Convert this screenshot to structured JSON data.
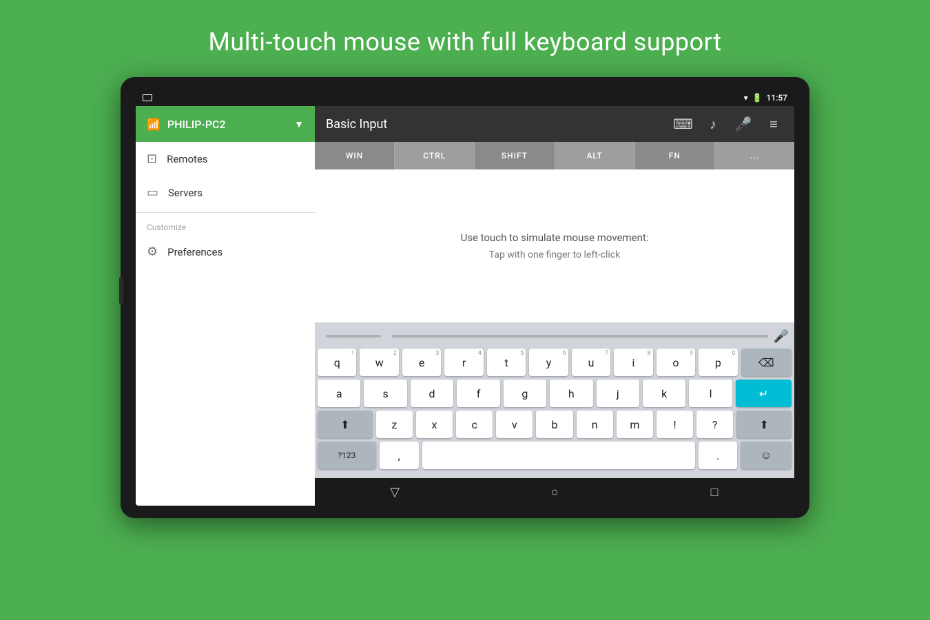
{
  "page": {
    "title": "Multi-touch mouse with full keyboard support",
    "background_color": "#4CAF50"
  },
  "status_bar": {
    "time": "11:57",
    "left_icon": "screen-icon"
  },
  "drawer": {
    "server_name": "PHILIP-PC2",
    "items": [
      {
        "id": "remotes",
        "label": "Remotes",
        "icon": "remotes-icon"
      },
      {
        "id": "servers",
        "label": "Servers",
        "icon": "servers-icon"
      }
    ],
    "section_label": "Customize",
    "customize_items": [
      {
        "id": "preferences",
        "label": "Preferences",
        "icon": "prefs-icon"
      }
    ]
  },
  "toolbar": {
    "title": "Basic Input",
    "icons": [
      "keyboard-icon",
      "music-icon",
      "mic-icon",
      "menu-icon"
    ]
  },
  "key_row": {
    "keys": [
      "WIN",
      "CTRL",
      "SHIFT",
      "ALT",
      "FN",
      "..."
    ]
  },
  "mouse_area": {
    "hint1": "Use touch to simulate mouse movement:",
    "hint2": "Tap with one finger to left-click"
  },
  "keyboard": {
    "rows": [
      {
        "keys": [
          {
            "label": "q",
            "number": "1"
          },
          {
            "label": "w",
            "number": "2"
          },
          {
            "label": "e",
            "number": "3"
          },
          {
            "label": "r",
            "number": "4"
          },
          {
            "label": "t",
            "number": "5"
          },
          {
            "label": "y",
            "number": "6"
          },
          {
            "label": "u",
            "number": "7"
          },
          {
            "label": "i",
            "number": "8"
          },
          {
            "label": "o",
            "number": "9"
          },
          {
            "label": "p",
            "number": "0"
          },
          {
            "label": "⌫",
            "type": "backspace"
          }
        ]
      },
      {
        "keys": [
          {
            "label": "a"
          },
          {
            "label": "s"
          },
          {
            "label": "d"
          },
          {
            "label": "f"
          },
          {
            "label": "g"
          },
          {
            "label": "h"
          },
          {
            "label": "j"
          },
          {
            "label": "k"
          },
          {
            "label": "l"
          },
          {
            "label": "↵",
            "type": "enter"
          }
        ]
      },
      {
        "keys": [
          {
            "label": "⬆",
            "type": "shift"
          },
          {
            "label": "z"
          },
          {
            "label": "x"
          },
          {
            "label": "c"
          },
          {
            "label": "v"
          },
          {
            "label": "b"
          },
          {
            "label": "n"
          },
          {
            "label": "m"
          },
          {
            "label": "!"
          },
          {
            "label": "?"
          },
          {
            "label": "⬆",
            "type": "shift"
          }
        ]
      },
      {
        "keys": [
          {
            "label": "?123",
            "type": "num-switch"
          },
          {
            "label": ",",
            "type": "comma"
          },
          {
            "label": "",
            "type": "space"
          },
          {
            "label": ".",
            "type": "dot"
          },
          {
            "label": "☺",
            "type": "emoji"
          }
        ]
      }
    ]
  },
  "bottom_nav": {
    "buttons": [
      "back-nav",
      "home-nav",
      "recent-nav"
    ]
  }
}
